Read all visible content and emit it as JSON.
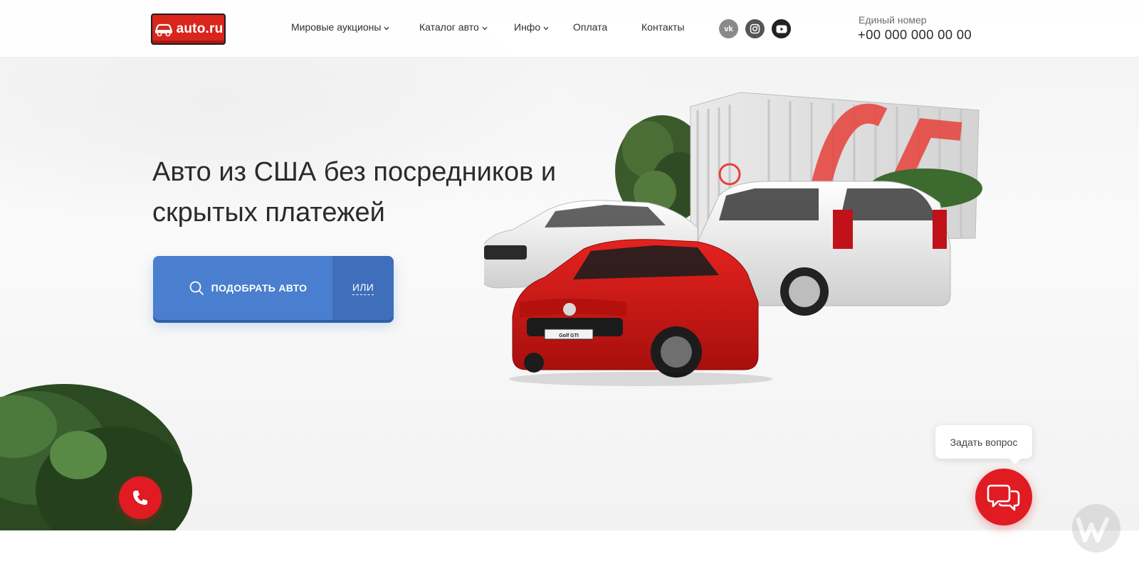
{
  "header": {
    "logo_text": "auto.ru",
    "nav": [
      {
        "label": "Мировые аукционы",
        "dropdown": true
      },
      {
        "label": "Каталог авто",
        "dropdown": true
      },
      {
        "label": "Инфо",
        "dropdown": true
      },
      {
        "label": "Оплата",
        "dropdown": false
      },
      {
        "label": "Контакты",
        "dropdown": false
      }
    ],
    "socials": [
      {
        "name": "vk-icon",
        "glyph": "vk"
      },
      {
        "name": "instagram-icon"
      },
      {
        "name": "youtube-icon"
      }
    ],
    "phone_label": "Единый номер",
    "phone_number": "+00 000 000 00 00"
  },
  "hero": {
    "headline": "Авто из США без посредников и скрытых платежей",
    "cta_label": "ПОДОБРАТЬ АВТО",
    "cta_or_label": "ИЛИ",
    "plate_text": "Golf GTI"
  },
  "widgets": {
    "ask_label": "Задать вопрос"
  },
  "colors": {
    "brand_red": "#e01b22",
    "cta_blue": "#4a7fcf",
    "text_dark": "#2b2b2b"
  }
}
